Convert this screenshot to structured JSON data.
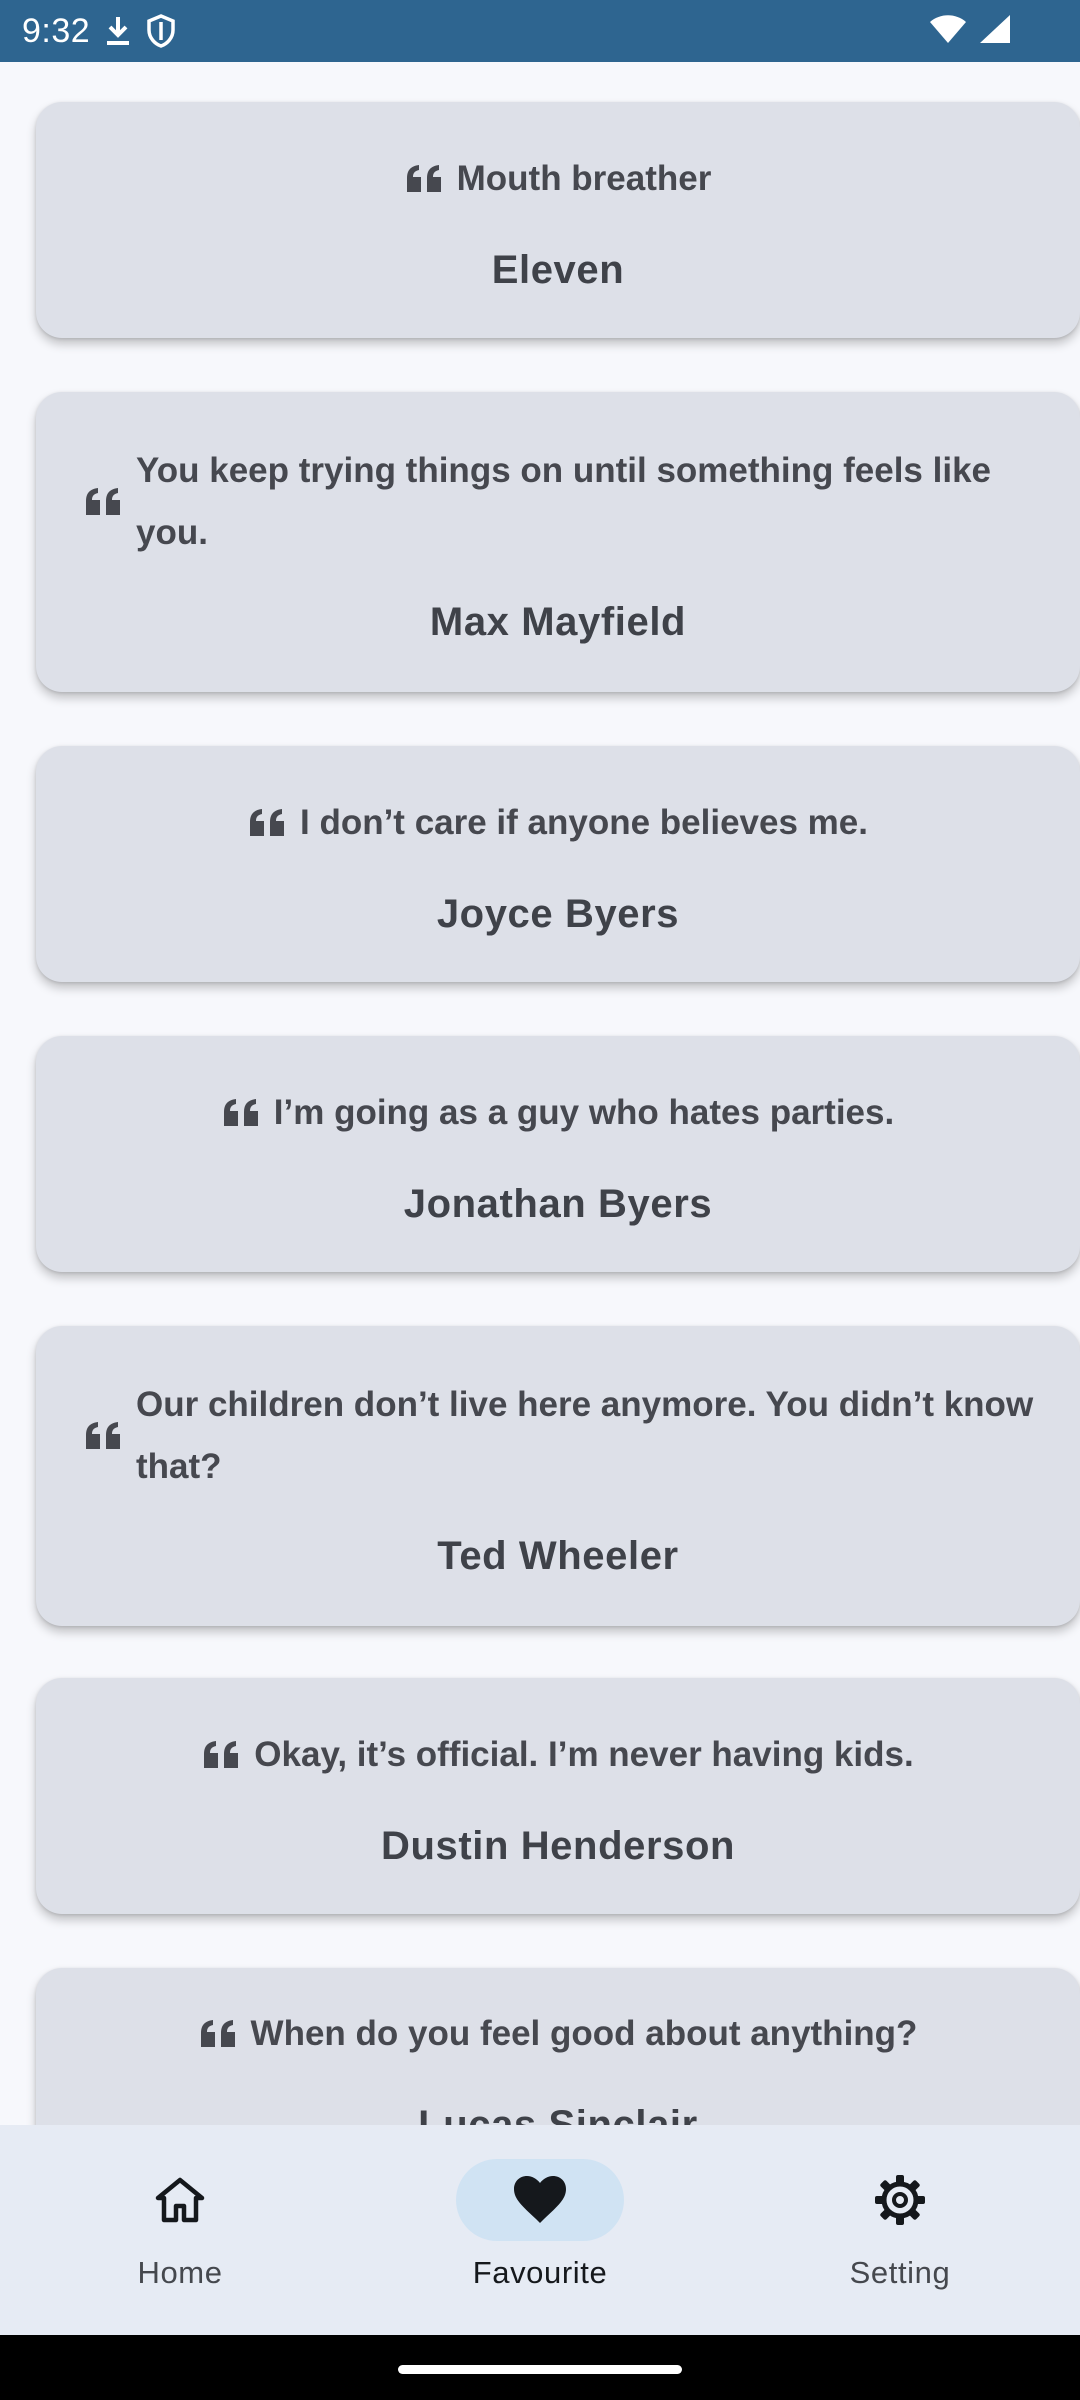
{
  "status_bar": {
    "time": "9:32",
    "icons": [
      "download-icon",
      "shield-icon",
      "wifi-icon",
      "signal-icon"
    ]
  },
  "quotes": [
    {
      "text": "Mouth breather",
      "author": "Eleven"
    },
    {
      "text": "You keep trying things on until something feels like you.",
      "author": "Max Mayfield"
    },
    {
      "text": "I don’t care if anyone believes me.",
      "author": "Joyce Byers"
    },
    {
      "text": "I’m going as a guy who hates parties.",
      "author": "Jonathan Byers"
    },
    {
      "text": "Our children don’t live here anymore. You didn’t know that?",
      "author": "Ted Wheeler"
    },
    {
      "text": "Okay, it’s official. I’m never having kids.",
      "author": "Dustin Henderson"
    },
    {
      "text": "When do you feel good about anything?",
      "author": "Lucas Sinclair"
    }
  ],
  "bottom_nav": {
    "items": [
      {
        "label": "Home",
        "icon": "home-icon"
      },
      {
        "label": "Favourite",
        "icon": "heart-icon",
        "active": true
      },
      {
        "label": "Setting",
        "icon": "gear-icon"
      }
    ]
  },
  "colors": {
    "status_bar": "#2e6590",
    "card": "#dde0e8",
    "nav_bg": "#e6ebf4",
    "active_pill": "#d0e3f3"
  }
}
